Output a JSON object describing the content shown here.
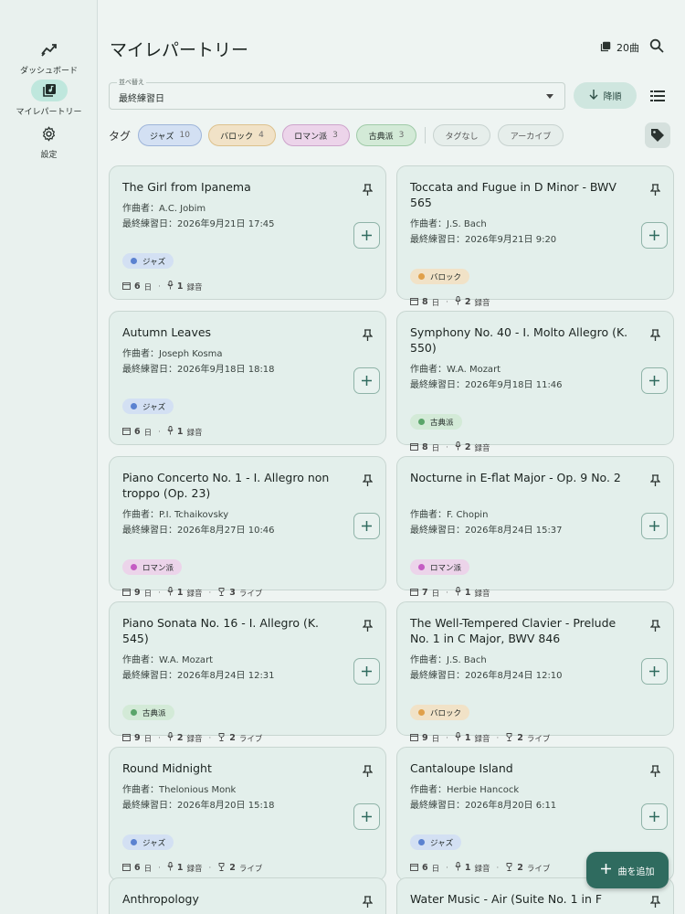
{
  "nav": {
    "items": [
      {
        "label": "ダッシュボード",
        "icon": "chart-icon"
      },
      {
        "label": "マイレパートリー",
        "icon": "library-icon"
      },
      {
        "label": "設定",
        "icon": "gear-icon"
      }
    ]
  },
  "header": {
    "title": "マイレパートリー",
    "count": "20曲"
  },
  "sort": {
    "legend": "並べ替え",
    "value": "最終練習日",
    "order_label": "降順"
  },
  "tags": {
    "label": "タグ",
    "chips": [
      {
        "name": "ジャズ",
        "count": "10",
        "bg": "#d3e0f3",
        "border": "#9db4d9"
      },
      {
        "name": "バロック",
        "count": "4",
        "bg": "#f1e2c7",
        "border": "#dcc18d"
      },
      {
        "name": "ロマン派",
        "count": "3",
        "bg": "#ecd4ea",
        "border": "#cda4cb"
      },
      {
        "name": "古典派",
        "count": "3",
        "bg": "#d3ead7",
        "border": "#9fcaa7"
      }
    ],
    "filters": [
      "タグなし",
      "アーカイブ"
    ]
  },
  "labels": {
    "composer_prefix": "作曲者：",
    "last_prefix": "最終練習日：",
    "days": "日",
    "recordings": "録音",
    "lives": "ライブ"
  },
  "cards": [
    {
      "title": "The Girl from Ipanema",
      "composer": "A.C. Jobim",
      "last": "2026年9月21日 17:45",
      "genre": "ジャズ",
      "genre_color": "#5b82d0",
      "genre_bg": "#d3e0f3",
      "days": "6",
      "rec": "1",
      "live": null
    },
    {
      "title": "Toccata and Fugue in D Minor - BWV 565",
      "composer": "J.S. Bach",
      "last": "2026年9月21日 9:20",
      "genre": "バロック",
      "genre_color": "#e0a04a",
      "genre_bg": "#f1e2c7",
      "days": "8",
      "rec": "2",
      "live": null
    },
    {
      "title": "Autumn Leaves",
      "composer": "Joseph Kosma",
      "last": "2026年9月18日 18:18",
      "genre": "ジャズ",
      "genre_color": "#5b82d0",
      "genre_bg": "#d3e0f3",
      "days": "6",
      "rec": "1",
      "live": null
    },
    {
      "title": "Symphony No. 40 - I. Molto Allegro (K. 550)",
      "composer": "W.A. Mozart",
      "last": "2026年9月18日 11:46",
      "genre": "古典派",
      "genre_color": "#5aa56a",
      "genre_bg": "#d3ead7",
      "days": "8",
      "rec": "2",
      "live": null
    },
    {
      "title": "Piano Concerto No. 1 - I. Allegro non troppo (Op. 23)",
      "composer": "P.I. Tchaikovsky",
      "last": "2026年8月27日 10:46",
      "genre": "ロマン派",
      "genre_color": "#c45cc3",
      "genre_bg": "#ecd4ea",
      "days": "9",
      "rec": "1",
      "live": "3"
    },
    {
      "title": "Nocturne in E-flat Major - Op. 9 No. 2",
      "composer": "F. Chopin",
      "last": "2026年8月24日 15:37",
      "genre": "ロマン派",
      "genre_color": "#c45cc3",
      "genre_bg": "#ecd4ea",
      "days": "7",
      "rec": "1",
      "live": null
    },
    {
      "title": "Piano Sonata No. 16 - I. Allegro (K. 545)",
      "composer": "W.A. Mozart",
      "last": "2026年8月24日 12:31",
      "genre": "古典派",
      "genre_color": "#5aa56a",
      "genre_bg": "#d3ead7",
      "days": "9",
      "rec": "2",
      "live": "2"
    },
    {
      "title": "The Well-Tempered Clavier - Prelude No. 1 in C Major, BWV 846",
      "composer": "J.S. Bach",
      "last": "2026年8月24日 12:10",
      "genre": "バロック",
      "genre_color": "#e0a04a",
      "genre_bg": "#f1e2c7",
      "days": "9",
      "rec": "1",
      "live": "2"
    },
    {
      "title": "Round Midnight",
      "composer": "Thelonious Monk",
      "last": "2026年8月20日 15:18",
      "genre": "ジャズ",
      "genre_color": "#5b82d0",
      "genre_bg": "#d3e0f3",
      "days": "6",
      "rec": "1",
      "live": "2"
    },
    {
      "title": "Cantaloupe Island",
      "composer": "Herbie Hancock",
      "last": "2026年8月20日 6:11",
      "genre": "ジャズ",
      "genre_color": "#5b82d0",
      "genre_bg": "#d3e0f3",
      "days": "6",
      "rec": "1",
      "live": "2"
    },
    {
      "title": "Anthropology",
      "composer": "",
      "last": "",
      "genre": "",
      "genre_color": "",
      "genre_bg": "",
      "days": "",
      "rec": "",
      "live": null
    },
    {
      "title": "Water Music - Air (Suite No. 1 in F",
      "composer": "",
      "last": "",
      "genre": "",
      "genre_color": "",
      "genre_bg": "",
      "days": "",
      "rec": "",
      "live": null
    }
  ],
  "fab": {
    "label": "曲を追加"
  }
}
